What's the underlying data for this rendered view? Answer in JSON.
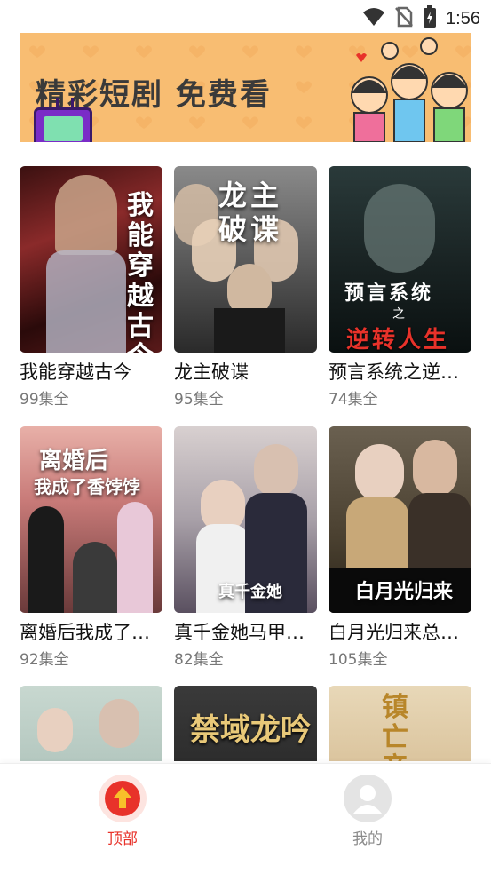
{
  "status_bar": {
    "time": "1:56",
    "icons": [
      "wifi-icon",
      "no-sim-icon",
      "battery-charging-icon"
    ]
  },
  "banner": {
    "text": "精彩短剧 免费看",
    "bg_color": "#f8bd72"
  },
  "dramas": [
    {
      "poster_text": "我能穿越古今",
      "title": "我能穿越古今",
      "episodes": "99集全"
    },
    {
      "poster_text": "龙主破谍",
      "title": "龙主破谍",
      "episodes": "95集全"
    },
    {
      "poster_text": "预言系统之逆转人生",
      "title": "预言系统之逆转人生",
      "episodes": "74集全"
    },
    {
      "poster_text": "离婚后我成了香饽饽",
      "title": "离婚后我成了香饽饽",
      "episodes": "92集全"
    },
    {
      "poster_text": "真千金她马甲曝光了",
      "title": "真千金她马甲曝光了",
      "episodes": "82集全"
    },
    {
      "poster_text": "白月光归来",
      "title": "白月光归来总裁追妻",
      "episodes": "105集全"
    },
    {
      "poster_text": "",
      "title": "",
      "episodes": ""
    },
    {
      "poster_text": "禁域龙吟",
      "title": "禁域龙吟",
      "episodes": ""
    },
    {
      "poster_text": "镇亡帝",
      "title": "镇亡帝",
      "episodes": ""
    }
  ],
  "bottom_nav": {
    "items": [
      {
        "label": "顶部",
        "icon": "arrow-up-icon",
        "active": true
      },
      {
        "label": "我的",
        "icon": "user-icon",
        "active": false
      }
    ]
  },
  "colors": {
    "accent": "#e8322a",
    "inactive": "#8a8a8a"
  }
}
